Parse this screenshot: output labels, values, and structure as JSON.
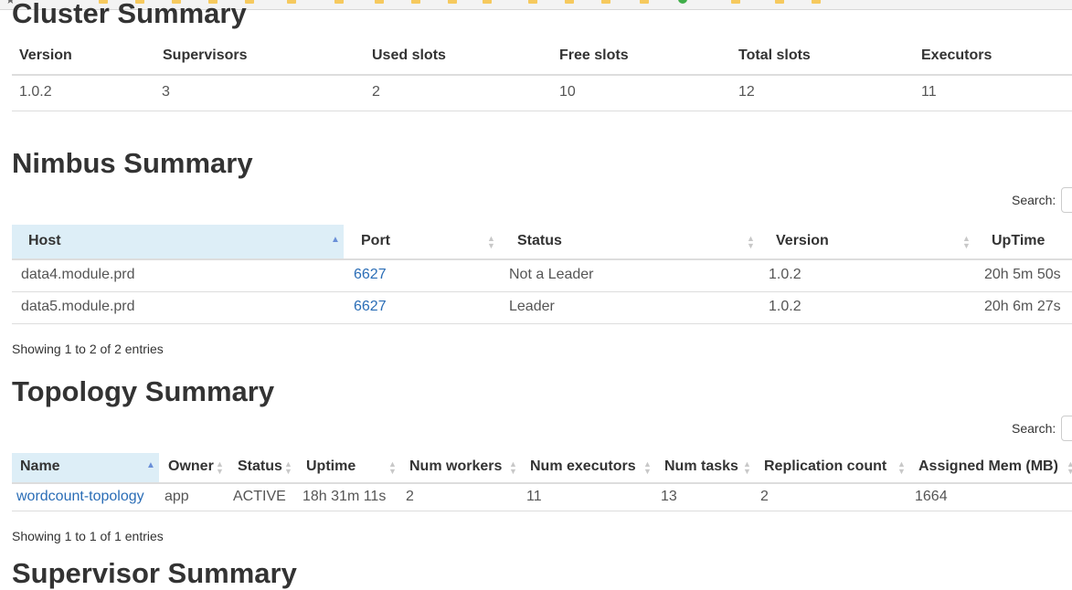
{
  "cluster_summary": {
    "title": "Cluster Summary",
    "headers": [
      "Version",
      "Supervisors",
      "Used slots",
      "Free slots",
      "Total slots",
      "Executors"
    ],
    "row": [
      "1.0.2",
      "3",
      "2",
      "10",
      "12",
      "11"
    ]
  },
  "nimbus_summary": {
    "title": "Nimbus Summary",
    "search_label": "Search:",
    "headers": [
      "Host",
      "Port",
      "Status",
      "Version",
      "UpTime"
    ],
    "rows": [
      [
        "data4.module.prd",
        "6627",
        "Not a Leader",
        "1.0.2",
        "20h 5m 50s"
      ],
      [
        "data5.module.prd",
        "6627",
        "Leader",
        "1.0.2",
        "20h 6m 27s"
      ]
    ],
    "info": "Showing 1 to 2 of 2 entries"
  },
  "topology_summary": {
    "title": "Topology Summary",
    "search_label": "Search:",
    "headers": [
      "Name",
      "Owner",
      "Status",
      "Uptime",
      "Num workers",
      "Num executors",
      "Num tasks",
      "Replication count",
      "Assigned Mem (MB)"
    ],
    "rows": [
      [
        "wordcount-topology",
        "app",
        "ACTIVE",
        "18h 31m 11s",
        "2",
        "11",
        "13",
        "2",
        "1664"
      ]
    ],
    "info": "Showing 1 to 1 of 1 entries"
  },
  "next_section_title": "Supervisor Summary",
  "colors": {
    "link": "#2a6db6",
    "sorted_header_bg": "#ddeef7",
    "sort_arrow": "#6a8fd8"
  }
}
